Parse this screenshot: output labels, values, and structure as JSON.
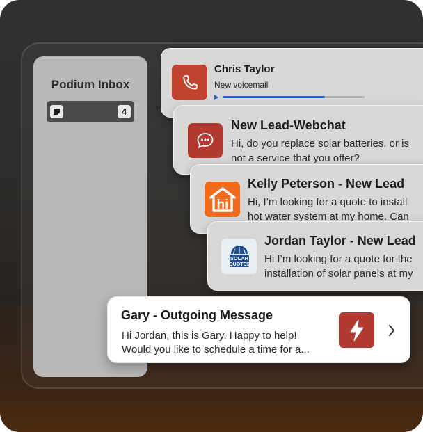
{
  "inbox": {
    "title": "Podium Inbox",
    "badge_count": "4"
  },
  "notifications": [
    {
      "title": "Chris Taylor",
      "subtitle": "New voicemail",
      "icon": "phone-icon",
      "playback_progress": 0.72
    },
    {
      "title": "New Lead-Webchat",
      "body_line1": "Hi, do you replace solar batteries, or is",
      "body_line2": "not a service that you offer?",
      "icon": "chat-bubble-icon"
    },
    {
      "title": "Kelly Peterson - New Lead",
      "body_line1": "Hi, I’m looking for a quote to install",
      "body_line2": "hot water system at my home. Can",
      "icon": "hipages-logo-icon",
      "logo_text": "hi"
    },
    {
      "title": "Jordan Taylor - New Lead",
      "body_line1": "Hi I’m looking for a quote for the",
      "body_line2": "installation of solar panels at my",
      "icon": "solar-quotes-logo-icon",
      "logo_line1": "SOLAR",
      "logo_line2": "QUOTES"
    }
  ],
  "outgoing": {
    "title": "Gary - Outgoing Message",
    "body_line1": "Hi Jordan, this is Gary. Happy to help!",
    "body_line2": "Would you like to schedule a time for a...",
    "icon": "lightning-bolt-icon"
  },
  "colors": {
    "brand_red": "#b23a30",
    "hipages_orange": "#f26a1b",
    "progress_blue": "#2a6bbf"
  }
}
